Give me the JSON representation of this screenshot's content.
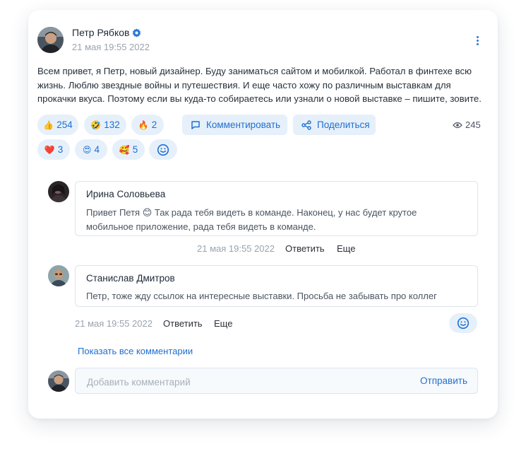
{
  "post": {
    "author": "Петр Рябков",
    "date": "21 мая 19:55 2022",
    "text": "Всем привет, я Петр, новый дизайнер. Буду заниматься сайтом и мобилкой. Работал в финтехе всю жизнь. Люблю звездные войны и путешествия. И еще часто хожу по различным выставкам для прокачки вкуса. Поэтому если вы куда-то собираетесь или узнали о новой выставке – пишите, зовите.",
    "views": "245"
  },
  "reactions": [
    {
      "emoji": "👍",
      "count": "254"
    },
    {
      "emoji": "🤣",
      "count": "132"
    },
    {
      "emoji": "🔥",
      "count": "2"
    },
    {
      "emoji": "❤️",
      "count": "3"
    },
    {
      "emoji": "😍",
      "count": "4"
    },
    {
      "emoji": "🥰",
      "count": "5"
    }
  ],
  "actions": {
    "comment_label": "Комментировать",
    "share_label": "Поделиться"
  },
  "comments": [
    {
      "author": "Ирина Соловьева",
      "text": "Привет Петя 😊 Так рада тебя видеть в команде. Наконец, у нас будет крутое мобильное приложение, рада тебя видеть в команде.",
      "date": "21 мая 19:55 2022",
      "reply_label": "Ответить",
      "more_label": "Еще"
    },
    {
      "author": "Станислав Дмитров",
      "text": "Петр, тоже жду ссылок на интересные выставки. Просьба не забывать про коллег",
      "date": "21 мая 19:55 2022",
      "reply_label": "Ответить",
      "more_label": "Еще"
    }
  ],
  "show_all_label": "Показать все комментарии",
  "composer": {
    "placeholder": "Добавить комментарий",
    "send_label": "Отправить"
  },
  "colors": {
    "accent": "#1f6fd0",
    "chip_bg": "#e6f0fb"
  }
}
